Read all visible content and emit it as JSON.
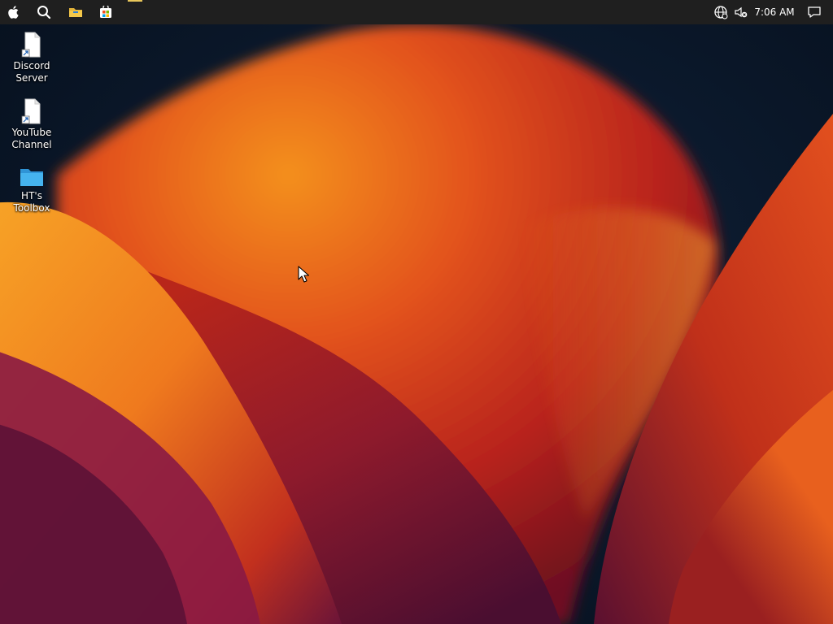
{
  "taskbar": {
    "apps": [
      {
        "name": "apple-menu",
        "icon": "apple-icon"
      },
      {
        "name": "search",
        "icon": "search-icon"
      },
      {
        "name": "file-explorer",
        "icon": "folder-icon"
      },
      {
        "name": "microsoft-store",
        "icon": "store-icon"
      }
    ],
    "tray": {
      "network_icon": "globe-icon",
      "volume_icon": "speaker-muted-icon",
      "clock": "7:06 AM",
      "notifications_icon": "notification-icon"
    }
  },
  "desktop": {
    "icons": [
      {
        "label_line1": "Discord",
        "label_line2": "Server",
        "icon": "document-shortcut-icon"
      },
      {
        "label_line1": "YouTube",
        "label_line2": "Channel",
        "icon": "document-shortcut-icon"
      },
      {
        "label_line1": "HT's Toolbox",
        "label_line2": "",
        "icon": "folder-icon"
      }
    ]
  },
  "colors": {
    "taskbar_bg": "#1f1f1f",
    "wallpaper_dark": "#0c1a30",
    "wallpaper_orange": "#f08a1c",
    "wallpaper_red": "#c8301a",
    "wallpaper_magenta": "#7a1846",
    "folder_blue": "#3aa8e8"
  }
}
